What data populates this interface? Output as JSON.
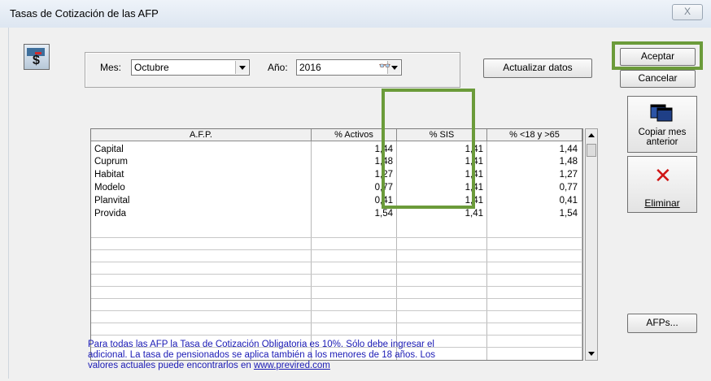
{
  "window": {
    "title": "Tasas de Cotización de las AFP",
    "close_glyph": "X"
  },
  "filters": {
    "mes_label": "Mes:",
    "mes_value": "Octubre",
    "anio_label": "Año:",
    "anio_value": "2016",
    "binoculars_glyph": "👓"
  },
  "buttons": {
    "actualizar": "Actualizar datos",
    "aceptar": "Aceptar",
    "cancelar": "Cancelar",
    "copiar": "Copiar mes anterior",
    "eliminar": "Eliminar",
    "afps": "AFPs..."
  },
  "table": {
    "columns": [
      "A.F.P.",
      "% Activos",
      "% SIS",
      "% <18 y >65"
    ],
    "rows": [
      [
        "Capital",
        "1,44",
        "1,41",
        "1,44"
      ],
      [
        "Cuprum",
        "1,48",
        "1,41",
        "1,48"
      ],
      [
        "Habitat",
        "1,27",
        "1,41",
        "1,27"
      ],
      [
        "Modelo",
        "0,77",
        "1,41",
        "0,77"
      ],
      [
        "Planvital",
        "0,41",
        "1,41",
        "0,41"
      ],
      [
        "Provida",
        "1,54",
        "1,41",
        "1,54"
      ]
    ]
  },
  "footer": {
    "line1": "Para todas las AFP la Tasa de Cotización Obligatoria es 10%. Sólo debe ingresar el",
    "line2": "adicional. La tasa de pensionados se aplica también a los menores de 18 años. Los",
    "line3_prefix": "valores actuales puede encontrarlos en ",
    "link": "www.previred.com"
  },
  "colors": {
    "highlight": "#6b9b3a",
    "link": "#1a1ab5",
    "delete_x": "#d01515"
  }
}
